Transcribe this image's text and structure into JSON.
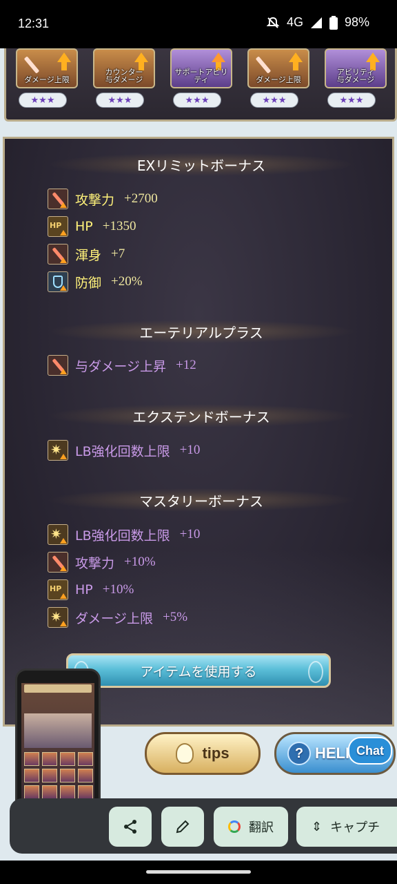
{
  "status_bar": {
    "time": "12:31",
    "network": "4G",
    "battery": "98%",
    "icons": [
      "bell-off-icon",
      "signal-icon",
      "battery-icon"
    ]
  },
  "support_abilities": [
    {
      "label": "ダメージ上限",
      "stars": "★★★",
      "icon": "sword-up-icon"
    },
    {
      "label": "カウンター\n与ダメージ",
      "stars": "★★★",
      "icon": "counter-up-icon"
    },
    {
      "label": "サポートアビリティ",
      "stars": "★★★",
      "icon": "star-plus-icon"
    },
    {
      "label": "ダメージ上限",
      "stars": "★★★",
      "icon": "sword-up-icon"
    },
    {
      "label": "アビリティ\n与ダメージ",
      "stars": "★★★",
      "icon": "ability-up-icon"
    }
  ],
  "sections": {
    "ex_limit": {
      "title": "EXリミットボーナス",
      "rows": [
        {
          "icon": "attack-up-icon",
          "name": "攻撃力",
          "value": "+2700"
        },
        {
          "icon": "hp-up-icon",
          "name": "HP",
          "value": "+1350"
        },
        {
          "icon": "attack-up-icon",
          "name": "渾身",
          "value": "+7"
        },
        {
          "icon": "defense-up-icon",
          "name": "防御",
          "value": "+20%"
        }
      ]
    },
    "ethereal": {
      "title": "エーテリアルプラス",
      "rows": [
        {
          "icon": "attack-up-icon",
          "name": "与ダメージ上昇",
          "value": "+12"
        }
      ]
    },
    "extend": {
      "title": "エクステンドボーナス",
      "rows": [
        {
          "icon": "burst-up-icon",
          "name": "LB強化回数上限",
          "value": "+10"
        }
      ]
    },
    "mastery": {
      "title": "マスタリーボーナス",
      "rows": [
        {
          "icon": "burst-up-icon",
          "name": "LB強化回数上限",
          "value": "+10"
        },
        {
          "icon": "attack-up-icon",
          "name": "攻撃力",
          "value": "+10%"
        },
        {
          "icon": "hp-up-icon",
          "name": "HP",
          "value": "+10%"
        },
        {
          "icon": "burst-up-icon",
          "name": "ダメージ上限",
          "value": "+5%"
        }
      ]
    }
  },
  "buttons": {
    "use_item": "アイテムを使用する",
    "tips": "tips",
    "help": "HELP",
    "chat": "Chat"
  },
  "action_bar": {
    "translate": "翻訳",
    "capture": "キャプチ"
  },
  "colors": {
    "stat_yellow": "#fff27a",
    "stat_purple": "#c99ae8",
    "frame_gold": "#b9ab8a",
    "action_chip": "#d7eadf"
  }
}
